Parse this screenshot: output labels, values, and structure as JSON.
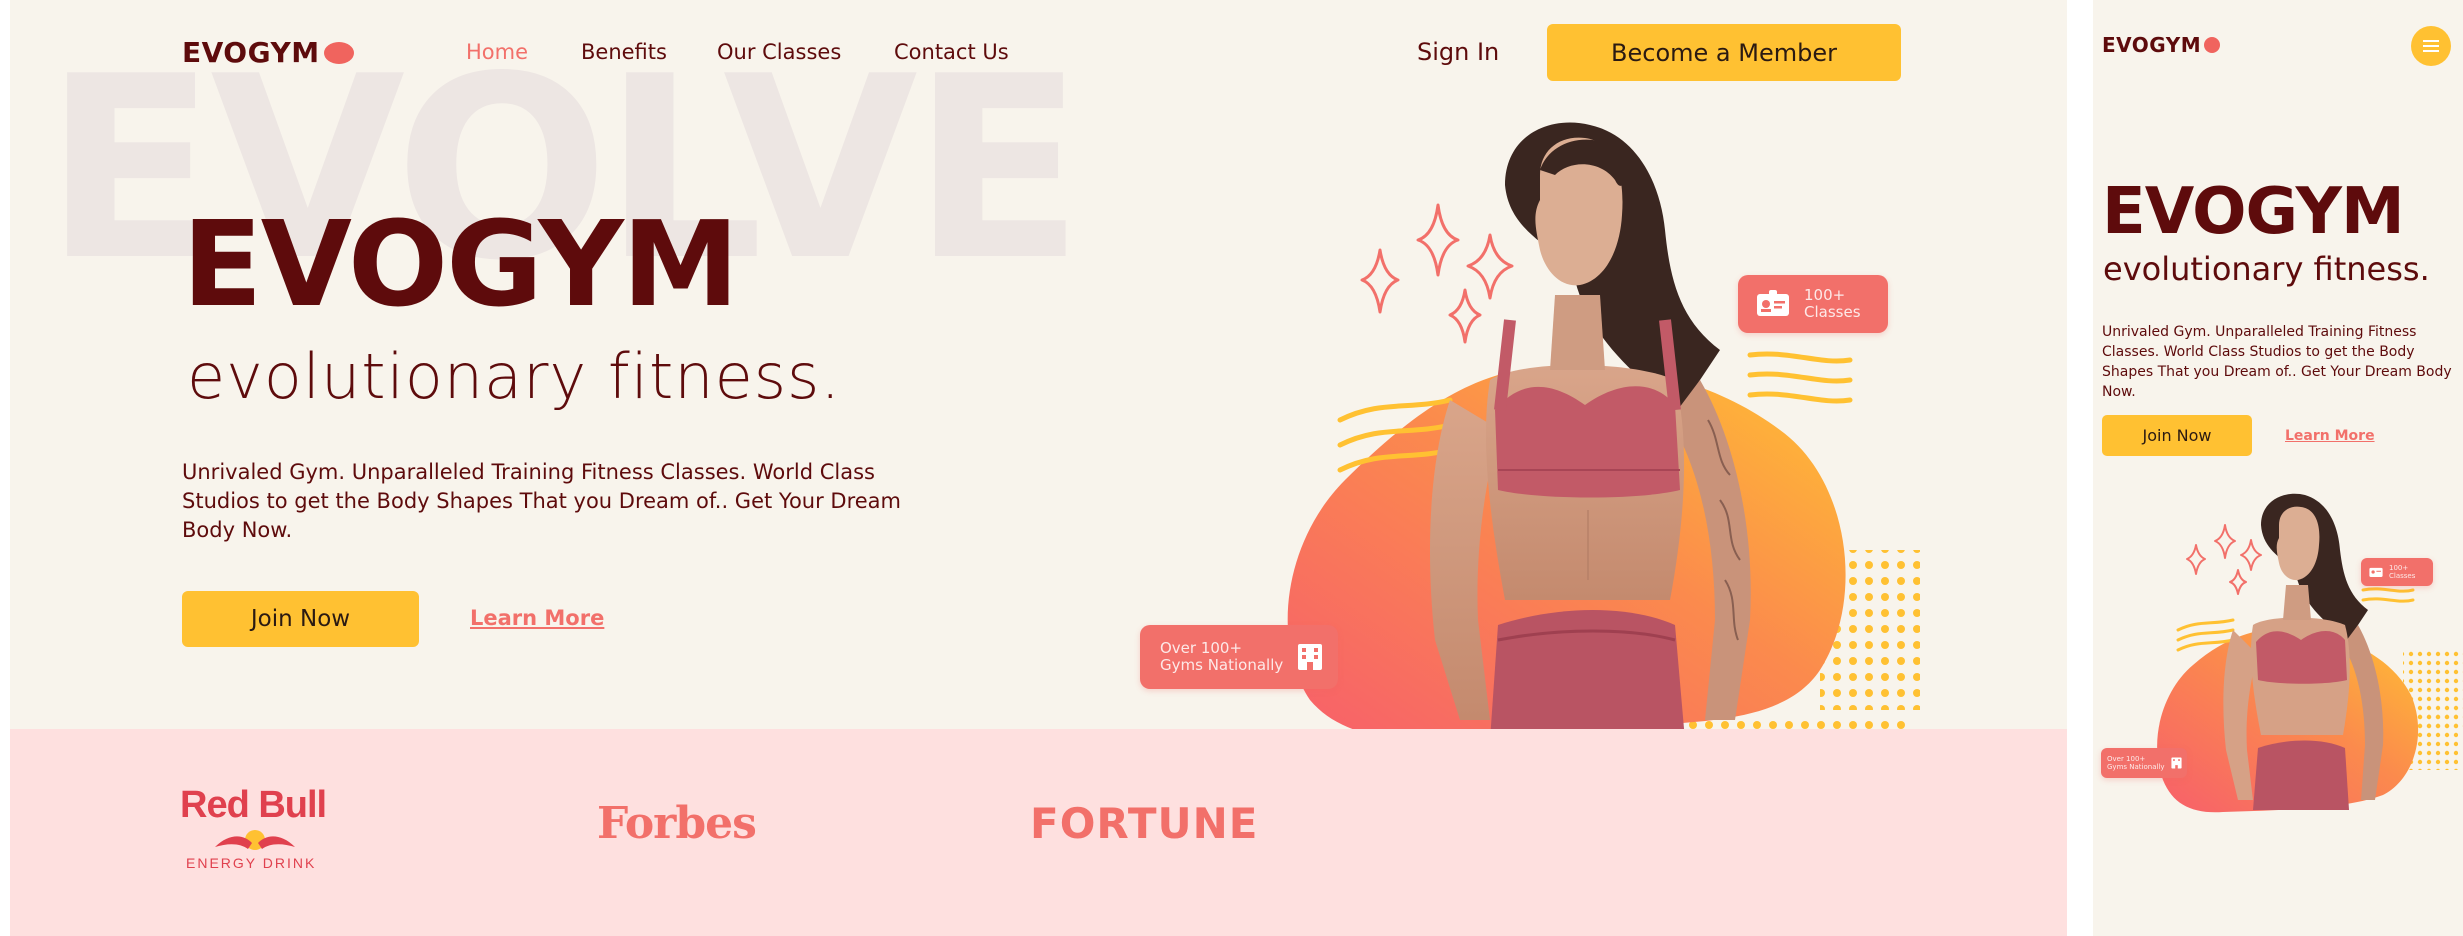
{
  "colors": {
    "brand_dark": "#5e0b0c",
    "accent_coral": "#f2706a",
    "accent_yellow": "#ffc132",
    "background": "#f8f4ec",
    "sponsor_band": "#fee0df",
    "watermark": "#ede6e3"
  },
  "desktop": {
    "header": {
      "logo": "EVOGYM",
      "nav": [
        "Home",
        "Benefits",
        "Our Classes",
        "Contact Us"
      ],
      "active_nav": "Home",
      "sign_in": "Sign In",
      "cta": "Become a Member"
    },
    "hero": {
      "watermark": "EVOLVE",
      "title": "EVOGYM",
      "subtitle": "evolutionary fitness.",
      "description": "Unrivaled Gym. Unparalleled Training Fitness Classes. World Class Studios to get the Body Shapes That you Dream of.. Get Your Dream Body Now.",
      "join_button": "Join Now",
      "learn_more": "Learn More",
      "badge_classes_line1": "100+",
      "badge_classes_line2": "Classes",
      "badge_gyms_line1": "Over 100+",
      "badge_gyms_line2": "Gyms Nationally"
    },
    "sponsors": {
      "redbull_line1": "Red Bull",
      "redbull_line2": "ENERGY DRINK",
      "forbes": "Forbes",
      "fortune": "FORTUNE"
    }
  },
  "mobile": {
    "logo": "EVOGYM",
    "menu_icon": "hamburger-icon",
    "title": "EVOGYM",
    "subtitle": "evolutionary fitness.",
    "description": "Unrivaled Gym. Unparalleled Training Fitness Classes. World Class Studios to get the Body Shapes That you Dream of.. Get Your Dream Body Now.",
    "join_button": "Join Now",
    "learn_more": "Learn More",
    "badge_classes_line1": "100+",
    "badge_classes_line2": "Classes",
    "badge_gyms_line1": "Over 100+",
    "badge_gyms_line2": "Gyms Nationally"
  },
  "icons": [
    "id-card-icon",
    "building-icon",
    "sparkle-icon",
    "hamburger-icon"
  ]
}
